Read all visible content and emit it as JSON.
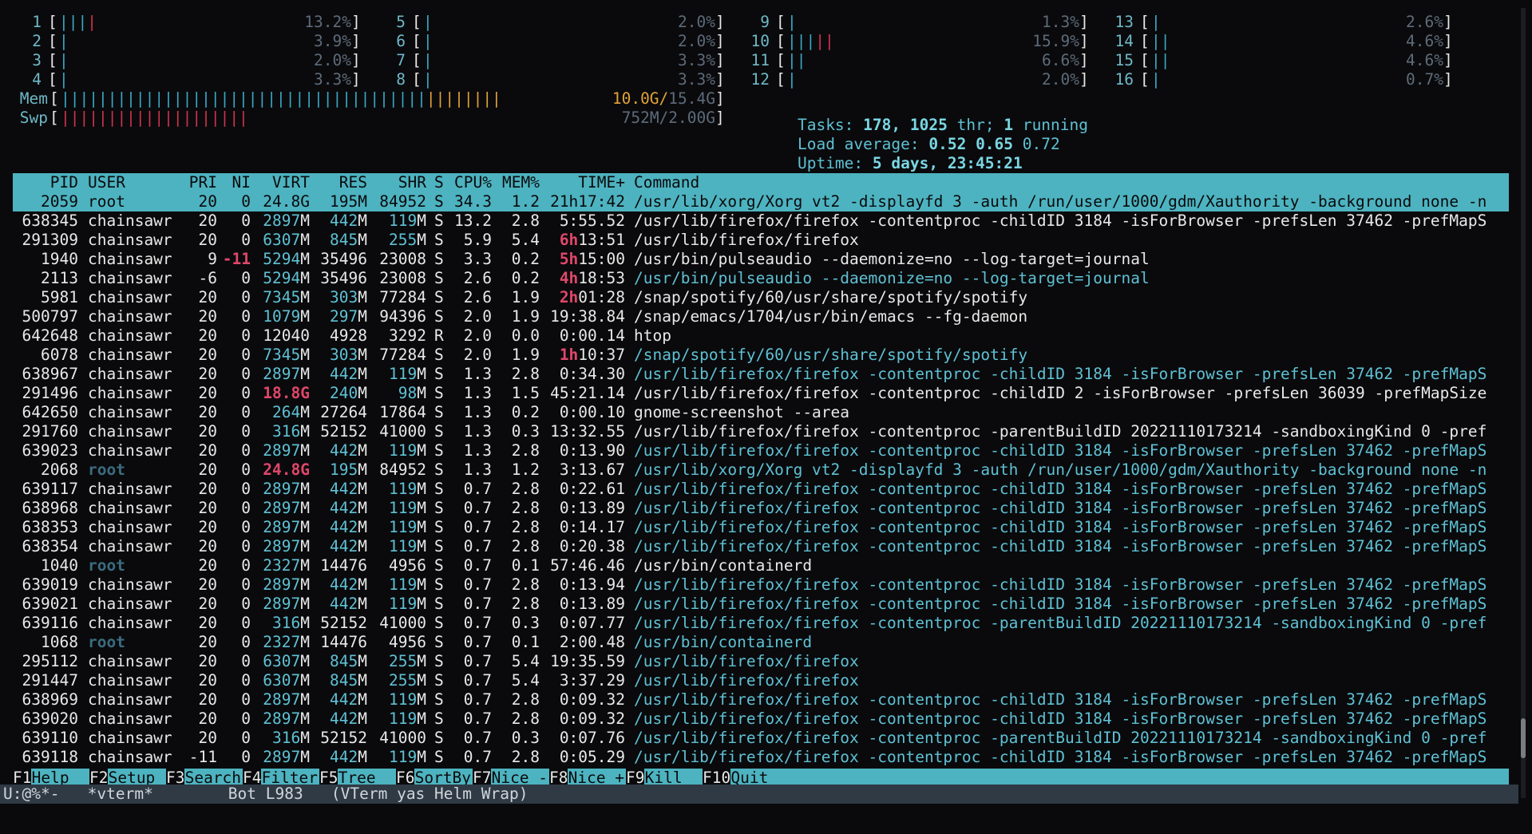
{
  "cpus": [
    {
      "n": "1",
      "val": "13.2%"
    },
    {
      "n": "2",
      "val": "3.9%"
    },
    {
      "n": "3",
      "val": "2.0%"
    },
    {
      "n": "4",
      "val": "3.3%"
    },
    {
      "n": "5",
      "val": "2.0%"
    },
    {
      "n": "6",
      "val": "2.0%"
    },
    {
      "n": "7",
      "val": "3.3%"
    },
    {
      "n": "8",
      "val": "3.3%"
    },
    {
      "n": "9",
      "val": "1.3%"
    },
    {
      "n": "10",
      "val": "15.9%"
    },
    {
      "n": "11",
      "val": "6.6%"
    },
    {
      "n": "12",
      "val": "2.0%"
    },
    {
      "n": "13",
      "val": "2.6%"
    },
    {
      "n": "14",
      "val": "4.6%"
    },
    {
      "n": "15",
      "val": "4.6%"
    },
    {
      "n": "16",
      "val": "0.7%"
    }
  ],
  "mem": {
    "label": "Mem",
    "used": "10.0G/",
    "total": "15.4G"
  },
  "swp": {
    "label": "Swp",
    "used": "752M/",
    "total": "2.00G"
  },
  "tasks": {
    "label": "Tasks:",
    "count": "178,",
    "thr": "1025",
    "thr_label": "thr;",
    "running": "1",
    "running_label": "running"
  },
  "load": {
    "label": "Load average:",
    "l1": "0.52",
    "l5": "0.65",
    "l15": "0.72"
  },
  "uptime": {
    "label": "Uptime:",
    "value": "5 days, 23:45:21"
  },
  "header": [
    "PID",
    "USER",
    "PRI",
    "NI",
    "VIRT",
    "RES",
    "SHR",
    "S",
    "CPU%",
    "MEM%",
    "TIME+",
    "Command"
  ],
  "processes": [
    {
      "pid": "2059",
      "user": "root",
      "pri": "20",
      "ni": "0",
      "virt": "24.8G",
      "res": "195M",
      "shr": "84952",
      "s": "S",
      "cpu": "34.3",
      "mem": "1.2",
      "time": "21h17:42",
      "cmd": "/usr/lib/xorg/Xorg vt2 -displayfd 3 -auth /run/user/1000/gdm/Xauthority -background none -n"
    },
    {
      "pid": "638345",
      "user": "chainsawr",
      "pri": "20",
      "ni": "0",
      "virt": "2897M",
      "res": "442M",
      "shr": "119M",
      "s": "S",
      "cpu": "13.2",
      "mem": "2.8",
      "time": "5:55.52",
      "cmd": "/usr/lib/firefox/firefox -contentproc -childID 3184 -isForBrowser -prefsLen 37462 -prefMapS"
    },
    {
      "pid": "291309",
      "user": "chainsawr",
      "pri": "20",
      "ni": "0",
      "virt": "6307M",
      "res": "845M",
      "shr": "255M",
      "s": "S",
      "cpu": "5.9",
      "mem": "5.4",
      "time_h": "6h",
      "time": "13:51",
      "cmd": "/usr/lib/firefox/firefox"
    },
    {
      "pid": "1940",
      "user": "chainsawr",
      "pri": "9",
      "ni": "-11",
      "virt": "5294M",
      "res": "35496",
      "shr": "23008",
      "s": "S",
      "cpu": "3.3",
      "mem": "0.2",
      "time_h": "5h",
      "time": "15:00",
      "cmd": "/usr/bin/pulseaudio --daemonize=no --log-target=journal"
    },
    {
      "pid": "2113",
      "user": "chainsawr",
      "pri": "-6",
      "ni": "0",
      "virt": "5294M",
      "res": "35496",
      "shr": "23008",
      "s": "S",
      "cpu": "2.6",
      "mem": "0.2",
      "time_h": "4h",
      "time": "18:53",
      "cmd": "/usr/bin/pulseaudio --daemonize=no --log-target=journal",
      "thread": true
    },
    {
      "pid": "5981",
      "user": "chainsawr",
      "pri": "20",
      "ni": "0",
      "virt": "7345M",
      "res": "303M",
      "shr": "77284",
      "s": "S",
      "cpu": "2.6",
      "mem": "1.9",
      "time_h": "2h",
      "time": "01:28",
      "cmd": "/snap/spotify/60/usr/share/spotify/spotify"
    },
    {
      "pid": "500797",
      "user": "chainsawr",
      "pri": "20",
      "ni": "0",
      "virt": "1079M",
      "res": "297M",
      "shr": "94396",
      "s": "S",
      "cpu": "2.0",
      "mem": "1.9",
      "time": "19:38.84",
      "cmd": "/snap/emacs/1704/usr/bin/emacs --fg-daemon"
    },
    {
      "pid": "642648",
      "user": "chainsawr",
      "pri": "20",
      "ni": "0",
      "virt": "12040",
      "res": "4928",
      "shr": "3292",
      "s": "R",
      "cpu": "2.0",
      "mem": "0.0",
      "time": "0:00.14",
      "cmd": "htop"
    },
    {
      "pid": "6078",
      "user": "chainsawr",
      "pri": "20",
      "ni": "0",
      "virt": "7345M",
      "res": "303M",
      "shr": "77284",
      "s": "S",
      "cpu": "2.0",
      "mem": "1.9",
      "time_h": "1h",
      "time": "10:37",
      "cmd": "/snap/spotify/60/usr/share/spotify/spotify",
      "thread": true
    },
    {
      "pid": "638967",
      "user": "chainsawr",
      "pri": "20",
      "ni": "0",
      "virt": "2897M",
      "res": "442M",
      "shr": "119M",
      "s": "S",
      "cpu": "1.3",
      "mem": "2.8",
      "time": "0:34.30",
      "cmd": "/usr/lib/firefox/firefox -contentproc -childID 3184 -isForBrowser -prefsLen 37462 -prefMapS",
      "thread": true
    },
    {
      "pid": "291496",
      "user": "chainsawr",
      "pri": "20",
      "ni": "0",
      "virt": "18.8G",
      "virt_red": true,
      "res": "240M",
      "shr": "98M",
      "s": "S",
      "cpu": "1.3",
      "mem": "1.5",
      "time": "45:21.14",
      "cmd": "/usr/lib/firefox/firefox -contentproc -childID 2 -isForBrowser -prefsLen 36039 -prefMapSize"
    },
    {
      "pid": "642650",
      "user": "chainsawr",
      "pri": "20",
      "ni": "0",
      "virt": "264M",
      "res": "27264",
      "shr": "17864",
      "s": "S",
      "cpu": "1.3",
      "mem": "0.2",
      "time": "0:00.10",
      "cmd": "gnome-screenshot --area"
    },
    {
      "pid": "291760",
      "user": "chainsawr",
      "pri": "20",
      "ni": "0",
      "virt": "316M",
      "res": "52152",
      "shr": "41000",
      "s": "S",
      "cpu": "1.3",
      "mem": "0.3",
      "time": "13:32.55",
      "cmd": "/usr/lib/firefox/firefox -contentproc -parentBuildID 20221110173214 -sandboxingKind 0 -pref"
    },
    {
      "pid": "639023",
      "user": "chainsawr",
      "pri": "20",
      "ni": "0",
      "virt": "2897M",
      "res": "442M",
      "shr": "119M",
      "s": "S",
      "cpu": "1.3",
      "mem": "2.8",
      "time": "0:13.90",
      "cmd": "/usr/lib/firefox/firefox -contentproc -childID 3184 -isForBrowser -prefsLen 37462 -prefMapS",
      "thread": true
    },
    {
      "pid": "2068",
      "user": "root",
      "user_dim": true,
      "pri": "20",
      "ni": "0",
      "virt": "24.8G",
      "virt_red": true,
      "res": "195M",
      "shr": "84952",
      "s": "S",
      "cpu": "1.3",
      "mem": "1.2",
      "time": "3:13.67",
      "cmd": "/usr/lib/xorg/Xorg vt2 -displayfd 3 -auth /run/user/1000/gdm/Xauthority -background none -n",
      "thread": true
    },
    {
      "pid": "639117",
      "user": "chainsawr",
      "pri": "20",
      "ni": "0",
      "virt": "2897M",
      "res": "442M",
      "shr": "119M",
      "s": "S",
      "cpu": "0.7",
      "mem": "2.8",
      "time": "0:22.61",
      "cmd": "/usr/lib/firefox/firefox -contentproc -childID 3184 -isForBrowser -prefsLen 37462 -prefMapS",
      "thread": true
    },
    {
      "pid": "638968",
      "user": "chainsawr",
      "pri": "20",
      "ni": "0",
      "virt": "2897M",
      "res": "442M",
      "shr": "119M",
      "s": "S",
      "cpu": "0.7",
      "mem": "2.8",
      "time": "0:13.89",
      "cmd": "/usr/lib/firefox/firefox -contentproc -childID 3184 -isForBrowser -prefsLen 37462 -prefMapS",
      "thread": true
    },
    {
      "pid": "638353",
      "user": "chainsawr",
      "pri": "20",
      "ni": "0",
      "virt": "2897M",
      "res": "442M",
      "shr": "119M",
      "s": "S",
      "cpu": "0.7",
      "mem": "2.8",
      "time": "0:14.17",
      "cmd": "/usr/lib/firefox/firefox -contentproc -childID 3184 -isForBrowser -prefsLen 37462 -prefMapS",
      "thread": true
    },
    {
      "pid": "638354",
      "user": "chainsawr",
      "pri": "20",
      "ni": "0",
      "virt": "2897M",
      "res": "442M",
      "shr": "119M",
      "s": "S",
      "cpu": "0.7",
      "mem": "2.8",
      "time": "0:20.38",
      "cmd": "/usr/lib/firefox/firefox -contentproc -childID 3184 -isForBrowser -prefsLen 37462 -prefMapS",
      "thread": true
    },
    {
      "pid": "1040",
      "user": "root",
      "user_dim": true,
      "pri": "20",
      "ni": "0",
      "virt": "2327M",
      "res": "14476",
      "shr": "4956",
      "s": "S",
      "cpu": "0.7",
      "mem": "0.1",
      "time": "57:46.46",
      "cmd": "/usr/bin/containerd"
    },
    {
      "pid": "639019",
      "user": "chainsawr",
      "pri": "20",
      "ni": "0",
      "virt": "2897M",
      "res": "442M",
      "shr": "119M",
      "s": "S",
      "cpu": "0.7",
      "mem": "2.8",
      "time": "0:13.94",
      "cmd": "/usr/lib/firefox/firefox -contentproc -childID 3184 -isForBrowser -prefsLen 37462 -prefMapS",
      "thread": true
    },
    {
      "pid": "639021",
      "user": "chainsawr",
      "pri": "20",
      "ni": "0",
      "virt": "2897M",
      "res": "442M",
      "shr": "119M",
      "s": "S",
      "cpu": "0.7",
      "mem": "2.8",
      "time": "0:13.89",
      "cmd": "/usr/lib/firefox/firefox -contentproc -childID 3184 -isForBrowser -prefsLen 37462 -prefMapS",
      "thread": true
    },
    {
      "pid": "639116",
      "user": "chainsawr",
      "pri": "20",
      "ni": "0",
      "virt": "316M",
      "res": "52152",
      "shr": "41000",
      "s": "S",
      "cpu": "0.7",
      "mem": "0.3",
      "time": "0:07.77",
      "cmd": "/usr/lib/firefox/firefox -contentproc -parentBuildID 20221110173214 -sandboxingKind 0 -pref",
      "thread": true
    },
    {
      "pid": "1068",
      "user": "root",
      "user_dim": true,
      "pri": "20",
      "ni": "0",
      "virt": "2327M",
      "res": "14476",
      "shr": "4956",
      "s": "S",
      "cpu": "0.7",
      "mem": "0.1",
      "time": "2:00.48",
      "cmd": "/usr/bin/containerd",
      "thread": true
    },
    {
      "pid": "295112",
      "user": "chainsawr",
      "pri": "20",
      "ni": "0",
      "virt": "6307M",
      "res": "845M",
      "shr": "255M",
      "s": "S",
      "cpu": "0.7",
      "mem": "5.4",
      "time": "19:35.59",
      "cmd": "/usr/lib/firefox/firefox",
      "thread": true
    },
    {
      "pid": "291447",
      "user": "chainsawr",
      "pri": "20",
      "ni": "0",
      "virt": "6307M",
      "res": "845M",
      "shr": "255M",
      "s": "S",
      "cpu": "0.7",
      "mem": "5.4",
      "time": "3:37.29",
      "cmd": "/usr/lib/firefox/firefox",
      "thread": true
    },
    {
      "pid": "638969",
      "user": "chainsawr",
      "pri": "20",
      "ni": "0",
      "virt": "2897M",
      "res": "442M",
      "shr": "119M",
      "s": "S",
      "cpu": "0.7",
      "mem": "2.8",
      "time": "0:09.32",
      "cmd": "/usr/lib/firefox/firefox -contentproc -childID 3184 -isForBrowser -prefsLen 37462 -prefMapS",
      "thread": true
    },
    {
      "pid": "639020",
      "user": "chainsawr",
      "pri": "20",
      "ni": "0",
      "virt": "2897M",
      "res": "442M",
      "shr": "119M",
      "s": "S",
      "cpu": "0.7",
      "mem": "2.8",
      "time": "0:09.32",
      "cmd": "/usr/lib/firefox/firefox -contentproc -childID 3184 -isForBrowser -prefsLen 37462 -prefMapS",
      "thread": true
    },
    {
      "pid": "639110",
      "user": "chainsawr",
      "pri": "20",
      "ni": "0",
      "virt": "316M",
      "res": "52152",
      "shr": "41000",
      "s": "S",
      "cpu": "0.7",
      "mem": "0.3",
      "time": "0:07.76",
      "cmd": "/usr/lib/firefox/firefox -contentproc -parentBuildID 20221110173214 -sandboxingKind 0 -pref",
      "thread": true
    },
    {
      "pid": "639118",
      "user": "chainsawr",
      "pri": "-11",
      "ni": "0",
      "virt": "2897M",
      "res": "442M",
      "shr": "119M",
      "s": "S",
      "cpu": "0.7",
      "mem": "2.8",
      "time": "0:05.29",
      "cmd": "/usr/lib/firefox/firefox -contentproc -childID 3184 -isForBrowser -prefsLen 37462 -prefMapS",
      "thread": true
    }
  ],
  "fkeys": [
    {
      "key": "F1",
      "label": "Help"
    },
    {
      "key": "F2",
      "label": "Setup"
    },
    {
      "key": "F3",
      "label": "Search"
    },
    {
      "key": "F4",
      "label": "Filter"
    },
    {
      "key": "F5",
      "label": "Tree"
    },
    {
      "key": "F6",
      "label": "SortBy"
    },
    {
      "key": "F7",
      "label": "Nice -"
    },
    {
      "key": "F8",
      "label": "Nice +"
    },
    {
      "key": "F9",
      "label": "Kill"
    },
    {
      "key": "F10",
      "label": "Quit"
    }
  ],
  "modeline": "U:@%*-   *vterm*        Bot L983   (VTerm yas Helm Wrap)"
}
